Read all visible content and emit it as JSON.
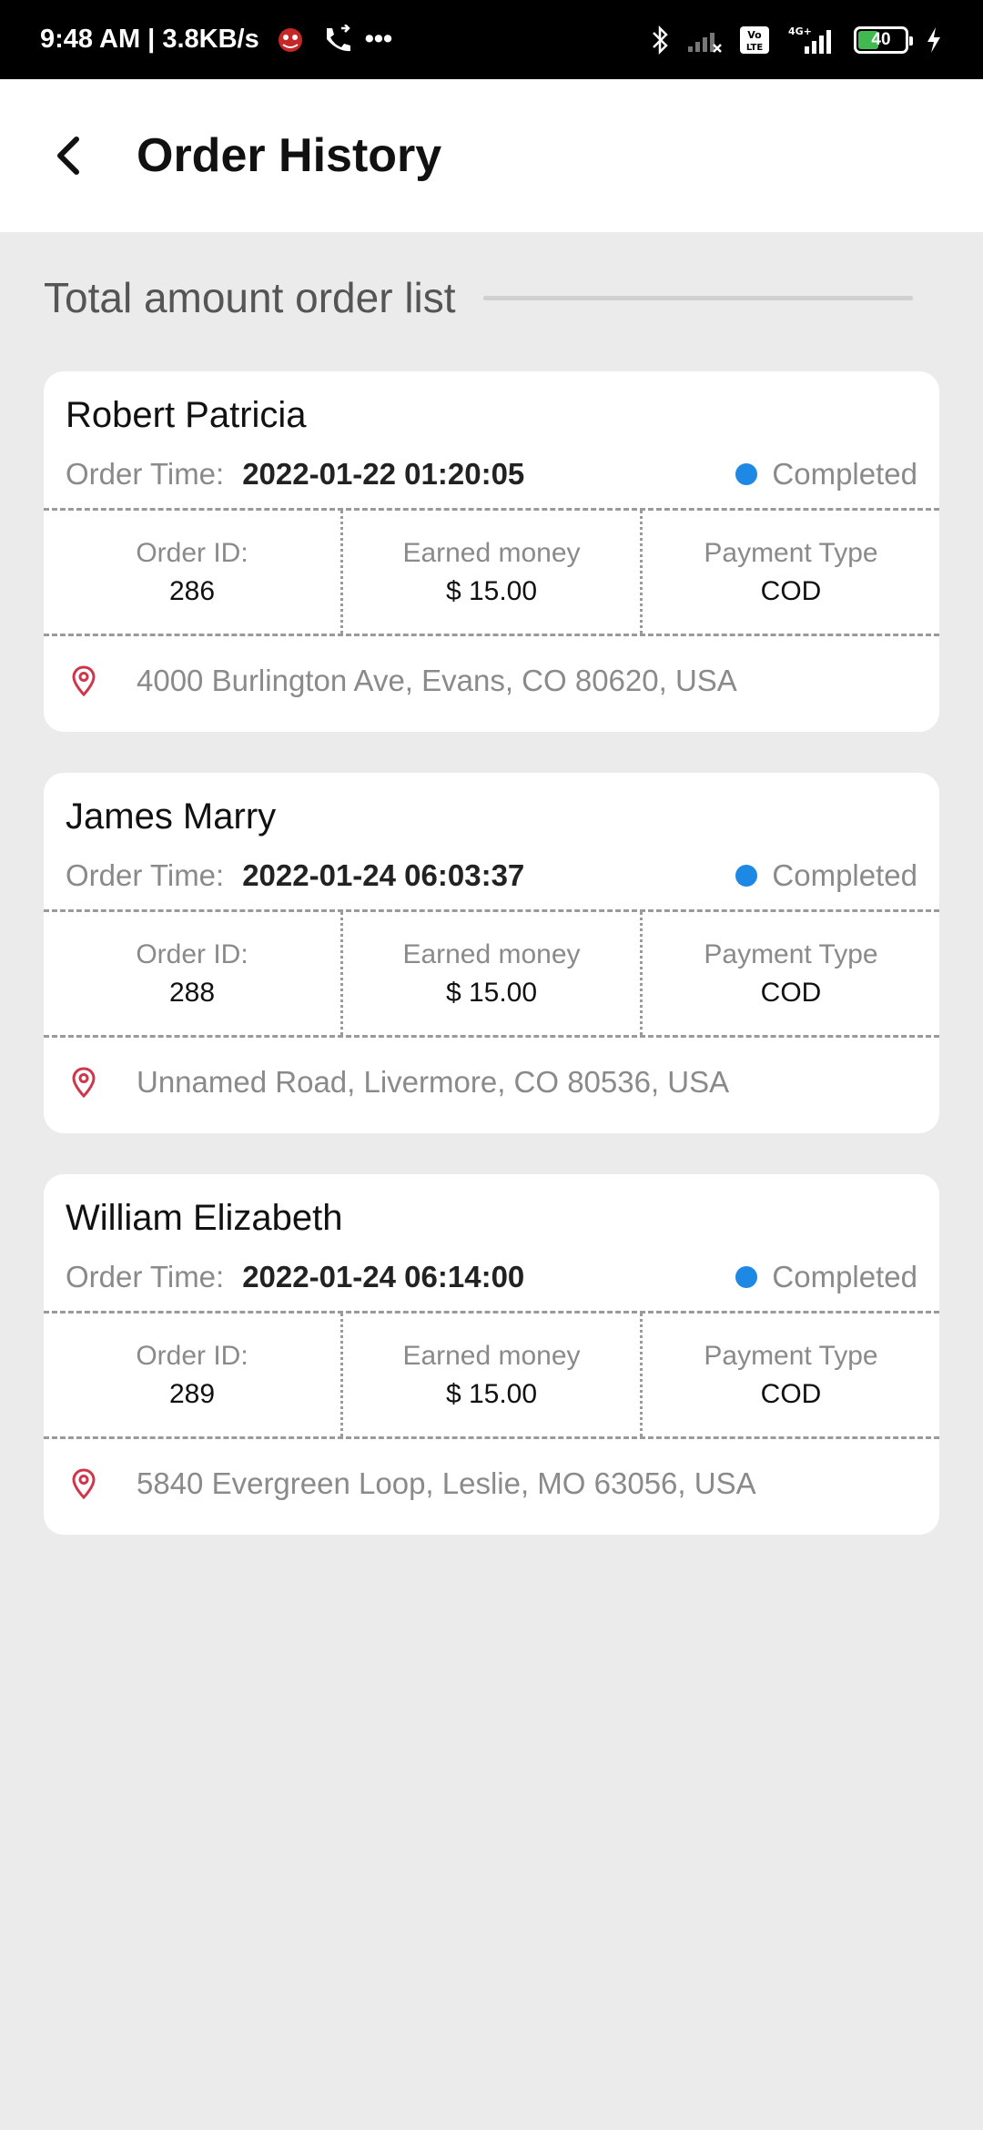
{
  "status_bar": {
    "time_speed": "9:48 AM | 3.8KB/s",
    "more": "•••",
    "battery": "40",
    "icons": [
      "emoji-sticker-icon",
      "call-forward-icon",
      "bluetooth-icon",
      "signal-weak-icon",
      "volte-icon",
      "4g-signal-icon",
      "battery-icon",
      "charging-icon"
    ]
  },
  "header": {
    "title": "Order History",
    "back_icon": "back-arrow-icon"
  },
  "section": {
    "title": "Total amount order list"
  },
  "labels": {
    "order_time": "Order Time:",
    "order_id": "Order ID:",
    "earned_money": "Earned money",
    "payment_type": "Payment Type"
  },
  "orders": [
    {
      "name": "Robert Patricia",
      "time": "2022-01-22 01:20:05",
      "status": "Completed",
      "order_id": "286",
      "earned": "$ 15.00",
      "payment": "COD",
      "address": "4000 Burlington Ave, Evans, CO 80620, USA"
    },
    {
      "name": "James Marry",
      "time": "2022-01-24 06:03:37",
      "status": "Completed",
      "order_id": "288",
      "earned": "$ 15.00",
      "payment": "COD",
      "address": "Unnamed Road, Livermore, CO 80536, USA"
    },
    {
      "name": "William Elizabeth",
      "time": "2022-01-24 06:14:00",
      "status": "Completed",
      "order_id": "289",
      "earned": "$ 15.00",
      "payment": "COD",
      "address": "5840 Evergreen Loop, Leslie, MO 63056, USA"
    }
  ],
  "colors": {
    "status_dot": "#1e88e5",
    "pin": "#d0364a",
    "background": "#ebebeb"
  }
}
